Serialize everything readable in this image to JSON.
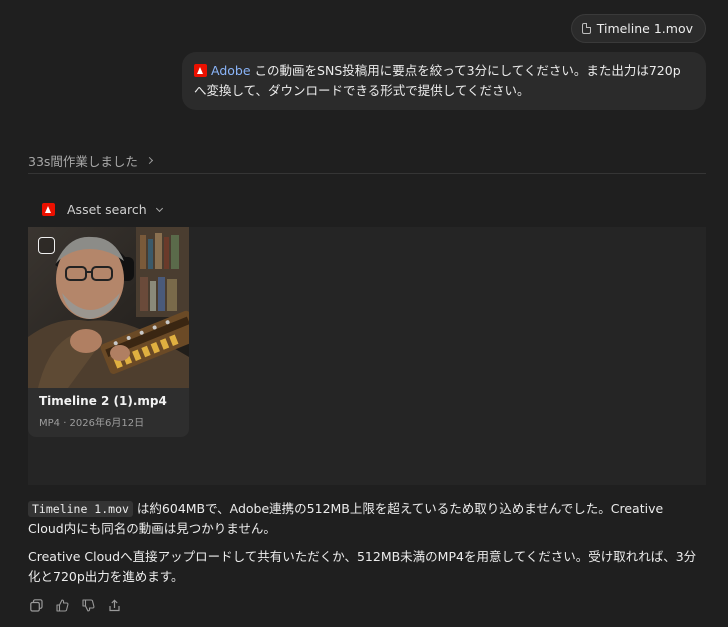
{
  "attachment": {
    "filename": "Timeline 1.mov"
  },
  "user_message": {
    "mention": "Adobe",
    "text": "この動画をSNS投稿用に要点を絞って3分にしてください。また出力は720pへ変換して、ダウンロードできる形式で提供してください。"
  },
  "work_summary": {
    "label": "33s間作業しました"
  },
  "tool": {
    "label": "Asset search"
  },
  "results": [
    {
      "name": "Timeline 2 (1).mp4",
      "meta": "MP4 · 2026年6月12日"
    }
  ],
  "reply": {
    "code_file": "Timeline 1.mov",
    "para1_rest": " は約604MBで、Adobe連携の512MB上限を超えているため取り込めませんでした。Creative Cloud内にも同名の動画は見つかりません。",
    "para2": "Creative Cloudへ直接アップロードして共有いただくか、512MB未満のMP4を用意してください。受け取れれば、3分化と720p出力を進めます。"
  },
  "colors": {
    "accent_link": "#8ab4f8",
    "adobe_red": "#eb1000",
    "background": "#1f1f1f"
  },
  "action_icons": [
    "copy-icon",
    "thumbs-up-icon",
    "thumbs-down-icon",
    "share-icon"
  ]
}
